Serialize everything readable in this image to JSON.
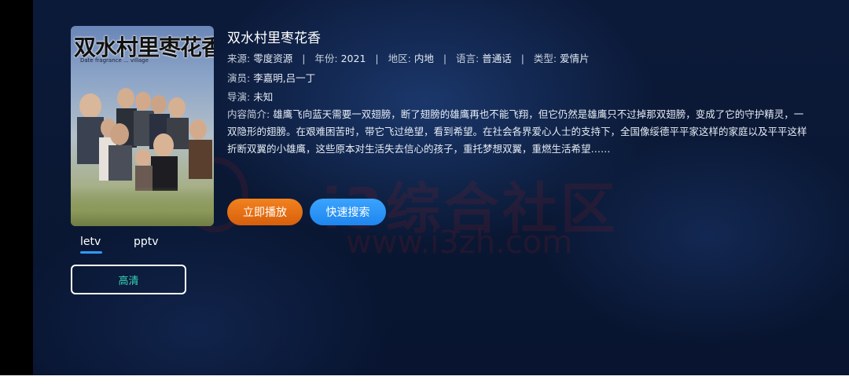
{
  "movie": {
    "title": "双水村里枣花香",
    "poster_title": "双水村里枣花香",
    "poster_subtitle": "Date fragrance ... village"
  },
  "meta": {
    "source_label": "来源:",
    "source_value": "零度资源",
    "year_label": "年份:",
    "year_value": "2021",
    "region_label": "地区:",
    "region_value": "内地",
    "language_label": "语言:",
    "language_value": "普通话",
    "genre_label": "类型:",
    "genre_value": "爱情片",
    "separator": "|"
  },
  "actors": {
    "label": "演员:",
    "value": "李嘉明,吕一丁"
  },
  "director": {
    "label": "导演:",
    "value": "未知"
  },
  "description": {
    "label": "内容简介:",
    "text": "雄鹰飞向蓝天需要一双翅膀，断了翅膀的雄鹰再也不能飞翔，但它仍然是雄鹰只不过掉那双翅膀，变成了它的守护精灵，一双隐形的翅膀。在艰难困苦时，带它飞过绝望，看到希望。在社会各界爱心人士的支持下，全国像绥德平平家这样的家庭以及平平这样折断双翼的小雄鹰，这些原本对生活失去信心的孩子，重托梦想双翼，重燃生活希望……"
  },
  "buttons": {
    "play": "立即播放",
    "search": "快速搜索"
  },
  "sources": {
    "tabs": [
      "letv",
      "pptv"
    ],
    "active": "letv"
  },
  "quality": {
    "label": "高清"
  },
  "watermark": {
    "brand": "i3综合社区",
    "url": "www.i3zh.com"
  },
  "colors": {
    "background": "#0a1834",
    "play_button": "#e8700f",
    "search_button": "#2a93f5",
    "tab_underline": "#2f9bff",
    "quality_text": "#37d4b6"
  }
}
